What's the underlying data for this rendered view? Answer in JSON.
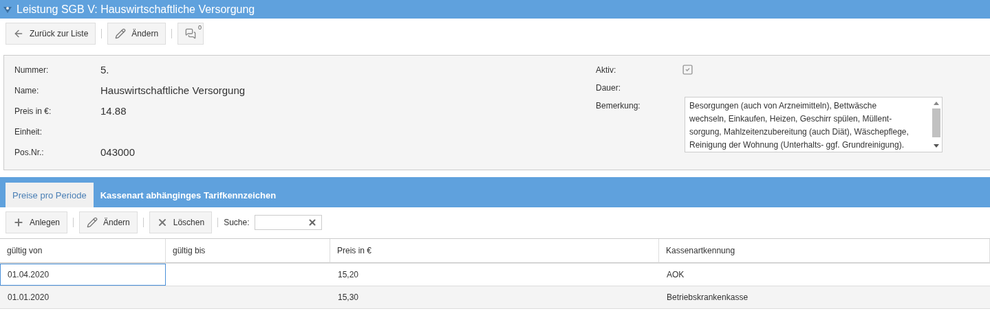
{
  "window": {
    "title": "Leistung SGB V: Hauswirtschaftliche Versorgung"
  },
  "toolbar": [
    {
      "kind": "back",
      "label": "Zurück zur Liste"
    },
    {
      "kind": "edit",
      "label": "Ändern"
    },
    {
      "kind": "comments",
      "badge": "0"
    }
  ],
  "details": {
    "left": [
      {
        "label": "Nummer:",
        "value": "5."
      },
      {
        "label": "Name:",
        "value": "Hauswirtschaftliche Versorgung"
      },
      {
        "label": "Preis in €:",
        "value": "14.88"
      },
      {
        "label": "Einheit:"
      },
      {
        "label": "Pos.Nr.:",
        "value": "043000"
      }
    ],
    "aktiv": {
      "label": "Aktiv:",
      "checked": true
    },
    "dauer": {
      "label": "Dauer:"
    },
    "remark": {
      "label": "Bemerkung:",
      "lines": [
        "Besorgungen (auch von Arzneimitteln), Bettwäsche",
        "wechseln, Einkaufen, Heizen, Geschirr spülen, Müllent-",
        "sorgung, Mahlzeitenzubereitung (auch Diät), Wäschepflege,",
        "Reinigung der Wohnung (Unterhalts- ggf. Grundreinigung)."
      ]
    }
  },
  "tabs": [
    {
      "label": "Preise pro Periode",
      "selected": true
    },
    {
      "label": "Kassenart abhänginges Tarifkennzeichen",
      "selected": false
    }
  ],
  "grid_toolbar": {
    "buttons": [
      {
        "kind": "add",
        "label": "Anlegen"
      },
      {
        "kind": "edit",
        "label": "Ändern"
      },
      {
        "kind": "delete",
        "label": "Löschen"
      }
    ],
    "search_label": "Suche:"
  },
  "table": {
    "columns": [
      "gültig von",
      "gültig bis",
      "Preis in €",
      "Kassenartkennung"
    ],
    "rows": [
      {
        "cells": [
          "01.04.2020",
          "",
          "15,20",
          "AOK"
        ],
        "focused": true
      },
      {
        "cells": [
          "01.01.2020",
          "",
          "15,30",
          "Betriebskrankenkasse"
        ],
        "focused": false
      }
    ]
  }
}
